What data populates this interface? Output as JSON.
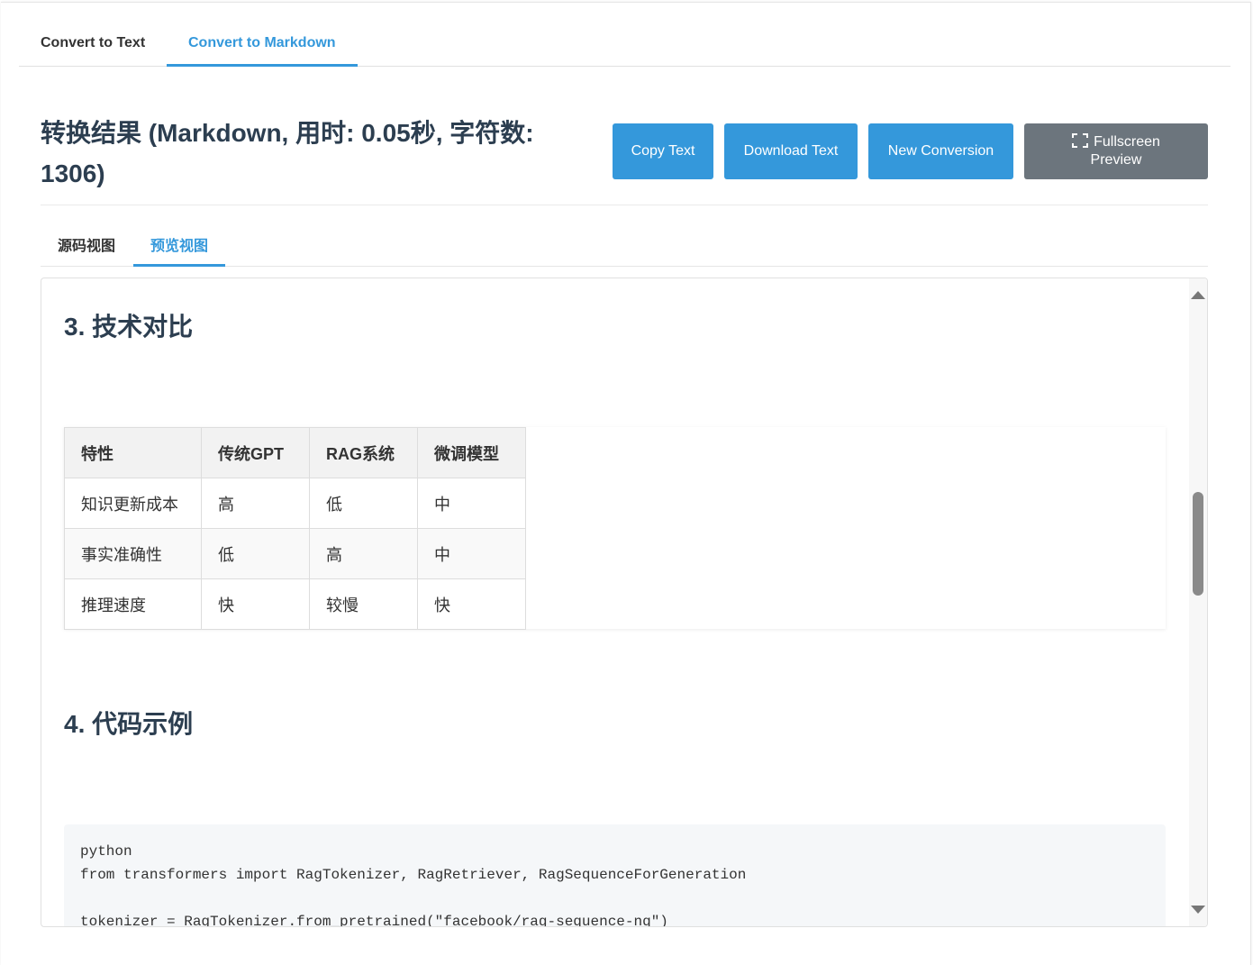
{
  "top_tabs": [
    {
      "label": "Convert to Text",
      "active": false
    },
    {
      "label": "Convert to Markdown",
      "active": true
    }
  ],
  "result": {
    "title": "转换结果 (Markdown, 用时: 0.05秒, 字符数: 1306)"
  },
  "buttons": {
    "copy": "Copy Text",
    "download": "Download Text",
    "new": "New Conversion",
    "fullscreen": "Fullscreen Preview"
  },
  "sub_tabs": [
    {
      "label": "源码视图",
      "active": false
    },
    {
      "label": "预览视图",
      "active": true
    }
  ],
  "preview": {
    "section3": "3. 技术对比",
    "table": {
      "headers": [
        "特性",
        "传统GPT",
        "RAG系统",
        "微调模型"
      ],
      "rows": [
        [
          "知识更新成本",
          "高",
          "低",
          "中"
        ],
        [
          "事实准确性",
          "低",
          "高",
          "中"
        ],
        [
          "推理速度",
          "快",
          "较慢",
          "快"
        ]
      ]
    },
    "section4": "4. 代码示例",
    "code_lines": [
      "python",
      "from transformers import RagTokenizer, RagRetriever, RagSequenceForGeneration",
      "",
      "tokenizer = RagTokenizer.from_pretrained(\"facebook/rag-sequence-nq\")"
    ]
  },
  "colors": {
    "accent": "#3498db",
    "secondary_button": "#6c757d",
    "heading": "#2c3e50"
  }
}
